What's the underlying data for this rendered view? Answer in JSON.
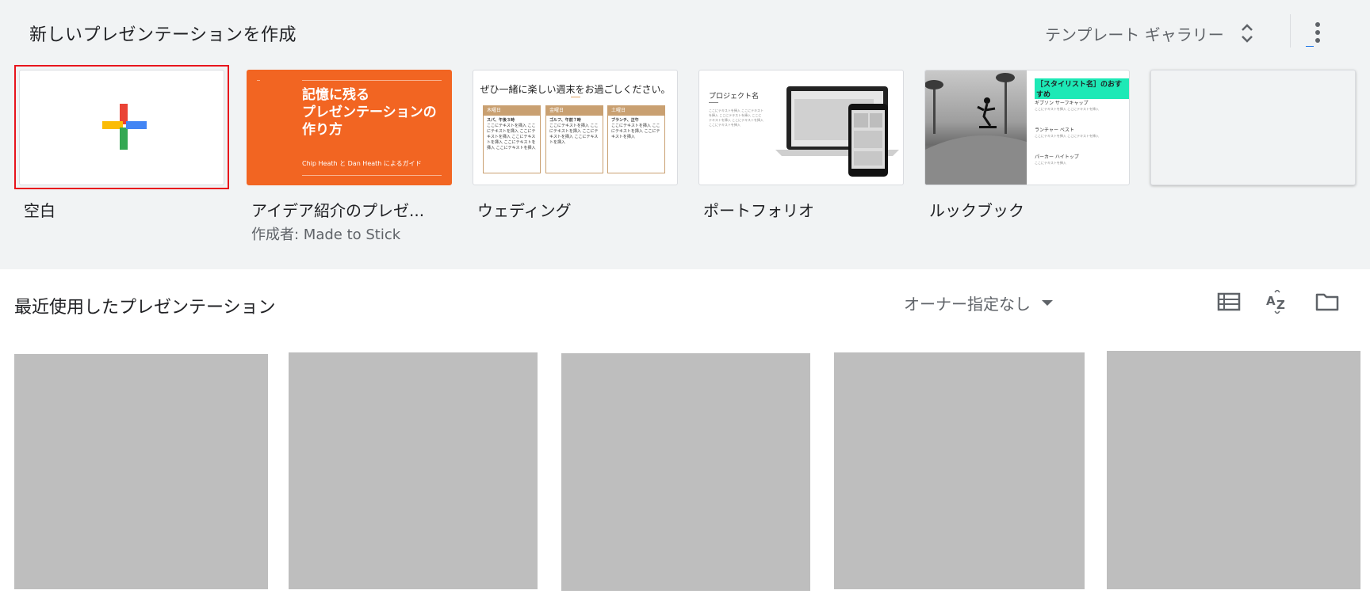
{
  "gallery": {
    "title": "新しいプレゼンテーションを作成",
    "toggle_label": "テンプレート ギャラリー",
    "templates": [
      {
        "name": "空白",
        "author": ""
      },
      {
        "name": "アイデア紹介のプレゼ...",
        "author": "作成者: Made to Stick",
        "thumb_title": "記憶に残る\nプレゼンテーションの\n作り方",
        "thumb_subtitle": "Chip Heath と Dan Heath によるガイド"
      },
      {
        "name": "ウェディング",
        "author": "",
        "thumb_title": "ぜひ一緒に楽しい週末をお過ごしください。",
        "columns": [
          {
            "day": "木曜日",
            "event": "スパ、午後３時",
            "text": "ここにテキストを挿入 ここにテキストを挿入 ここにテキストを挿入 ここにテキストを挿入 ここにテキストを挿入 ここにテキストを挿入"
          },
          {
            "day": "金曜日",
            "event": "ゴルフ、午前７時",
            "text": "ここにテキストを挿入 ここにテキストを挿入 ここにテキストを挿入 ここにテキストを挿入"
          },
          {
            "day": "土曜日",
            "event": "ブランチ、正午",
            "text": "ここにテキストを挿入 ここにテキストを挿入 ここにテキストを挿入"
          }
        ]
      },
      {
        "name": "ポートフォリオ",
        "author": "",
        "thumb_title": "プロジェクト名",
        "thumb_text": "ここにテキストを挿入 ここにテキストを挿入 ここにテキストを挿入 ここにテキストを挿入 ここにテキストを挿入 ここにテキストを挿入"
      },
      {
        "name": "ルックブック",
        "author": "",
        "thumb_title": "［スタイリスト名］のおすすめ",
        "items": [
          {
            "title": "ギブソン サーフキャップ",
            "text": "ここにテキストを挿入 ここにテキストを挿入"
          },
          {
            "title": "ランチャー ベスト",
            "text": "ここにテキストを挿入 ここにテキストを挿入"
          },
          {
            "title": "パーカー ハイトップ",
            "text": "ここにテキストを挿入"
          }
        ]
      },
      {
        "name": "",
        "author": ""
      }
    ]
  },
  "recent": {
    "title": "最近使用したプレゼンテーション",
    "owner_filter": "オーナー指定なし"
  },
  "colors": {
    "gallery_bg": "#f1f3f4",
    "selection": "#e8141c",
    "orange": "#f26522",
    "doc_placeholder": "#bebebe"
  }
}
